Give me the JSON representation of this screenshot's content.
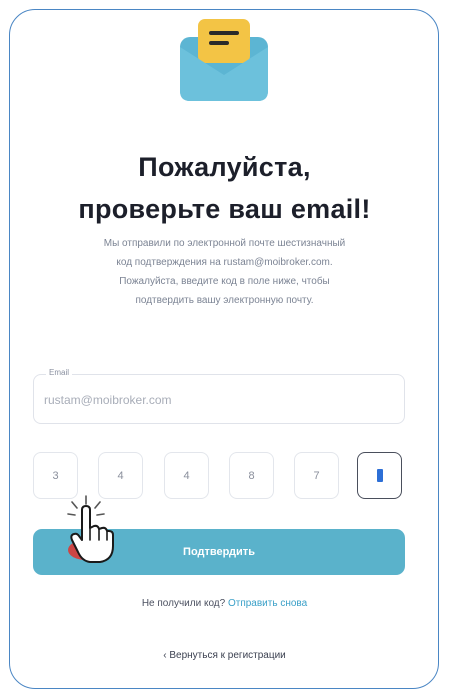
{
  "header": {
    "title_line1": "Пожалуйста,",
    "title_line2": "проверьте ваш email!"
  },
  "description": {
    "line1": "Мы отправили по электронной почте шестизначный",
    "line2": "код подтверждения на rustam@moibroker.com.",
    "line3": "Пожалуйста, введите код в поле ниже, чтобы",
    "line4": "подтвердить вашу электронную почту."
  },
  "email_field": {
    "label": "Email",
    "value": "rustam@moibroker.com"
  },
  "code": {
    "digits": [
      "3",
      "4",
      "4",
      "8",
      "7",
      ""
    ]
  },
  "confirm_button": {
    "label": "Подтвердить"
  },
  "resend": {
    "prompt": "Не получили код?",
    "link": "Отправить снова"
  },
  "back_link": {
    "label": "‹ Вернуться к регистрации"
  },
  "icons": {
    "envelope": "envelope-icon",
    "cursor": "hand-pointer-icon"
  },
  "colors": {
    "accent": "#5ab2cb",
    "link": "#3aa0c8",
    "border": "#4a86c4",
    "envelope_letter": "#f3c445"
  }
}
